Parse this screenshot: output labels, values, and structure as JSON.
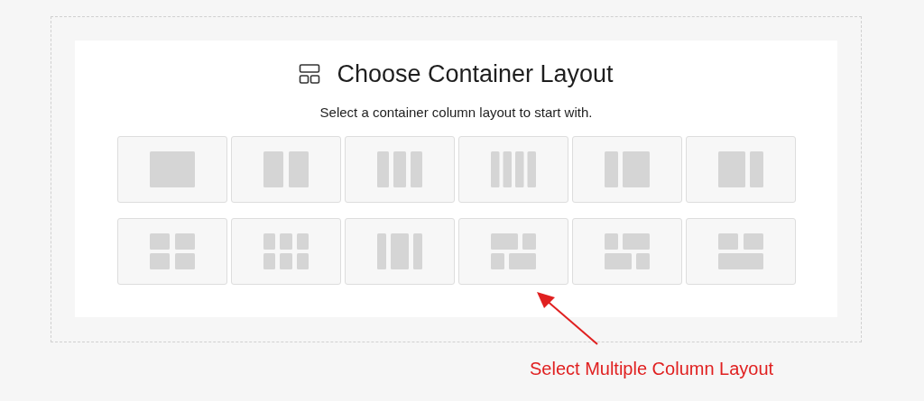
{
  "dialog": {
    "title": "Choose Container Layout",
    "subtitle": "Select a container column layout to start with.",
    "layouts": [
      {
        "kind": "full"
      },
      {
        "kind": "halves"
      },
      {
        "kind": "thirds"
      },
      {
        "kind": "quarters"
      },
      {
        "kind": "left-narrow"
      },
      {
        "kind": "right-narrow"
      },
      {
        "kind": "grid-four"
      },
      {
        "kind": "grid-six"
      },
      {
        "kind": "wide-center"
      },
      {
        "kind": "mixed-a"
      },
      {
        "kind": "mixed-b"
      },
      {
        "kind": "two-over-one"
      }
    ]
  },
  "annotation": {
    "text": "Select Multiple Column Layout"
  }
}
